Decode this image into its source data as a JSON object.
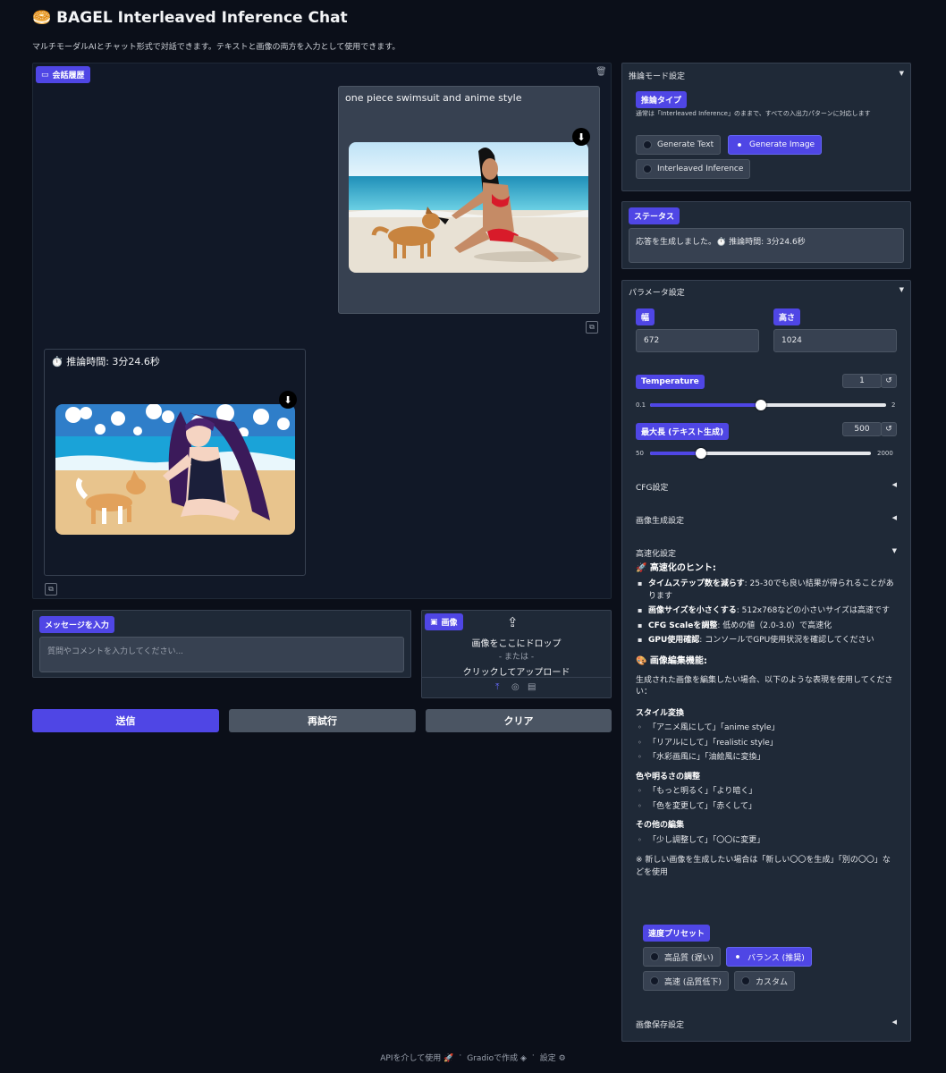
{
  "header": {
    "title": "BAGEL Interleaved Inference Chat",
    "subtitle": "マルチモーダルAIとチャット形式で対話できます。テキストと画像の両方を入力として使用できます。"
  },
  "chat": {
    "label": "会話履歴",
    "user_message": "one piece swimsuit and anime style",
    "bot_time": "⏱️ 推論時間: 3分24.6秒"
  },
  "message_input": {
    "label": "メッセージを入力",
    "placeholder": "質問やコメントを入力してください..."
  },
  "image_upload": {
    "label": "画像",
    "drop_text": "画像をここにドロップ",
    "or_text": "- または -",
    "click_text": "クリックしてアップロード"
  },
  "buttons": {
    "send": "送信",
    "retry": "再試行",
    "clear": "クリア"
  },
  "inference_mode": {
    "title": "推論モード設定",
    "type_label": "推論タイプ",
    "description": "通常は「Interleaved Inference」のままで、すべての入出力パターンに対応します",
    "options": [
      "Generate Text",
      "Generate Image",
      "Interleaved Inference"
    ],
    "selected": "Generate Image"
  },
  "status": {
    "label": "ステータス",
    "text": "応答を生成しました。⏱️ 推論時間: 3分24.6秒"
  },
  "params": {
    "title": "パラメータ設定",
    "width_label": "幅",
    "width_value": "672",
    "height_label": "高さ",
    "height_value": "1024",
    "temperature": {
      "label": "Temperature",
      "value": "1",
      "min": "0.1",
      "max": "2",
      "fraction": 0.47
    },
    "max_length": {
      "label": "最大長 (テキスト生成)",
      "value": "500",
      "min": "50",
      "max": "2000",
      "fraction": 0.23
    },
    "cfg_section": "CFG設定",
    "imggen_section": "画像生成設定",
    "speed_section": "高速化設定",
    "save_section": "画像保存設定"
  },
  "tips": {
    "speed_title": "🚀 高速化のヒント:",
    "speed_items": [
      {
        "bold": "タイムステップ数を減らす",
        "text": ": 25-30でも良い結果が得られることがあります"
      },
      {
        "bold": "画像サイズを小さくする",
        "text": ": 512x768などの小さいサイズは高速です"
      },
      {
        "bold": "CFG Scaleを調整",
        "text": ": 低めの値（2.0-3.0）で高速化"
      },
      {
        "bold": "GPU使用確認",
        "text": ": コンソールでGPU使用状況を確認してください"
      }
    ],
    "edit_title": "🎨 画像編集機能:",
    "edit_intro": "生成された画像を編集したい場合、以下のような表現を使用してください：",
    "style_title": "スタイル変換",
    "style_items": [
      "「アニメ風にして」「anime style」",
      "「リアルにして」「realistic style」",
      "「水彩画風に」「油絵風に変換」"
    ],
    "color_title": "色や明るさの調整",
    "color_items": [
      "「もっと明るく」「より暗く」",
      "「色を変更して」「赤くして」"
    ],
    "other_title": "その他の編集",
    "other_items": [
      "「少し調整して」「〇〇に変更」"
    ],
    "note": "※ 新しい画像を生成したい場合は「新しい〇〇を生成」「別の〇〇」などを使用"
  },
  "preset": {
    "label": "速度プリセット",
    "options": [
      "高品質 (遅い)",
      "バランス (推奨)",
      "高速 (品質低下)",
      "カスタム"
    ],
    "selected": "バランス (推奨)"
  },
  "footer": {
    "api": "APIを介して使用",
    "gradio": "Gradioで作成",
    "settings": "設定"
  }
}
